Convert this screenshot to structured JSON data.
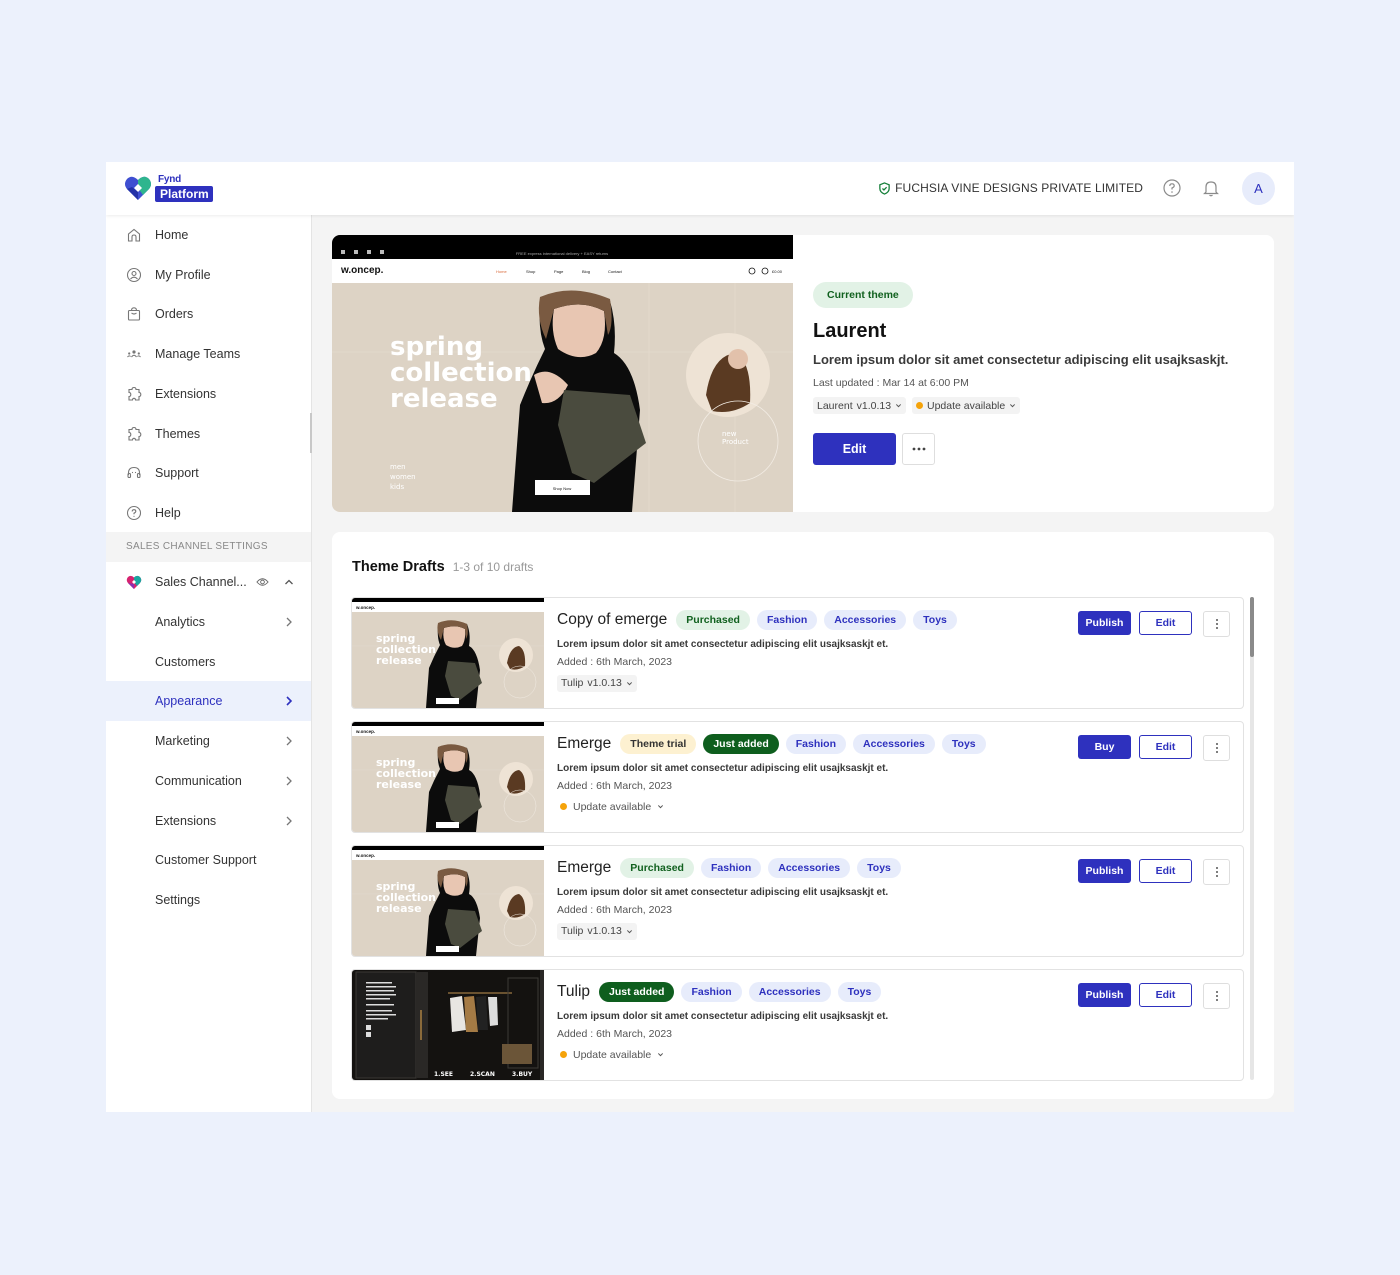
{
  "brand": {
    "top": "Fynd",
    "bottom": "Platform"
  },
  "header": {
    "org_name": "FUCHSIA VINE DESIGNS PRIVATE LIMITED",
    "help_icon": "help-circle-icon",
    "notification_icon": "bell-icon",
    "avatar_initial": "A"
  },
  "sidebar": {
    "items": [
      {
        "label": "Home",
        "icon": "home-icon"
      },
      {
        "label": "My Profile",
        "icon": "user-circle-icon"
      },
      {
        "label": "Orders",
        "icon": "shopping-bag-icon"
      },
      {
        "label": "Manage Teams",
        "icon": "team-icon"
      },
      {
        "label": "Extensions",
        "icon": "puzzle-icon"
      },
      {
        "label": "Themes",
        "icon": "puzzle-icon"
      },
      {
        "label": "Support",
        "icon": "headset-icon"
      },
      {
        "label": "Help",
        "icon": "help-circle-icon"
      }
    ],
    "section_header": "SALES CHANNEL SETTINGS",
    "channel": {
      "label": "Sales Channel...",
      "expanded": true
    },
    "sub_items": [
      {
        "label": "Analytics",
        "has_chevron": true
      },
      {
        "label": "Customers",
        "has_chevron": false
      },
      {
        "label": "Appearance",
        "has_chevron": true,
        "active": true
      },
      {
        "label": "Marketing",
        "has_chevron": true
      },
      {
        "label": "Communication",
        "has_chevron": true
      },
      {
        "label": "Extensions",
        "has_chevron": true
      },
      {
        "label": "Customer Support",
        "has_chevron": false
      },
      {
        "label": "Settings",
        "has_chevron": false
      }
    ]
  },
  "current_theme": {
    "badge": "Current theme",
    "name": "Laurent",
    "description": "Lorem ipsum dolor sit amet consectetur adipiscing elit usajksaskjt.",
    "last_updated": "Last updated : Mar 14 at 6:00 PM",
    "version_theme": "Laurent",
    "version": "v1.0.13",
    "update_status": "Update available",
    "edit_label": "Edit",
    "preview": {
      "announcement": "FREE express international delivery + EASY returns",
      "store_logo": "w.oncep.",
      "nav": [
        "Home",
        "Shop",
        "Page",
        "Blog",
        "Contact"
      ],
      "cart_total": "£0.00",
      "headline": [
        "spring",
        "collection",
        "release"
      ],
      "categories": [
        "men",
        "women",
        "kids"
      ],
      "cta": "Shop Now",
      "badge": [
        "new",
        "Product"
      ]
    }
  },
  "drafts": {
    "title": "Theme Drafts",
    "count": "1-3 of 10 drafts",
    "items": [
      {
        "name": "Copy of emerge",
        "status_tags": [
          {
            "label": "Purchased",
            "style": "green-soft"
          }
        ],
        "tags": [
          "Fashion",
          "Accessories",
          "Toys"
        ],
        "description": "Lorem ipsum dolor sit amet consectetur adipiscing elit usajksaskjt et.",
        "added": "Added : 6th March, 2023",
        "meta_type": "version",
        "version_theme": "Tulip",
        "version": "v1.0.13",
        "primary_action": "Publish",
        "secondary_action": "Edit",
        "thumbnail": "spring-collection"
      },
      {
        "name": "Emerge",
        "status_tags": [
          {
            "label": "Theme trial",
            "style": "cream"
          },
          {
            "label": "Just added",
            "style": "green-dark"
          }
        ],
        "tags": [
          "Fashion",
          "Accessories",
          "Toys"
        ],
        "description": "Lorem ipsum dolor sit amet consectetur adipiscing elit usajksaskjt et.",
        "added": "Added : 6th March, 2023",
        "meta_type": "update",
        "update_status": "Update available",
        "primary_action": "Buy",
        "secondary_action": "Edit",
        "thumbnail": "spring-collection"
      },
      {
        "name": "Emerge",
        "status_tags": [
          {
            "label": "Purchased",
            "style": "green-soft"
          }
        ],
        "tags": [
          "Fashion",
          "Accessories",
          "Toys"
        ],
        "description": "Lorem ipsum dolor sit amet consectetur adipiscing elit usajksaskjt et.",
        "added": "Added : 6th March, 2023",
        "meta_type": "version",
        "version_theme": "Tulip",
        "version": "v1.0.13",
        "primary_action": "Publish",
        "secondary_action": "Edit",
        "thumbnail": "spring-collection"
      },
      {
        "name": "Tulip",
        "status_tags": [
          {
            "label": "Just added",
            "style": "green-dark"
          }
        ],
        "tags": [
          "Fashion",
          "Accessories",
          "Toys"
        ],
        "description": "Lorem ipsum dolor sit amet consectetur adipiscing elit usajksaskjt et.",
        "added": "Added : 6th March, 2023",
        "meta_type": "update",
        "update_status": "Update available",
        "primary_action": "Publish",
        "secondary_action": "Edit",
        "thumbnail": "store-front",
        "thumbnail_text": [
          "1.SEE",
          "2.SCAN",
          "3.BUY"
        ]
      }
    ]
  },
  "colors": {
    "primary": "#2e31be",
    "page_bg": "#ecf1fc",
    "active_bg": "#ecf1fc",
    "purchased_bg": "#e2f2e6",
    "purchased_text": "#11611f",
    "just_added_bg": "#0e5e1e",
    "trial_bg": "#fdf1d1",
    "tag_bg": "#e7ecfb",
    "update_dot": "#f5a30a"
  }
}
